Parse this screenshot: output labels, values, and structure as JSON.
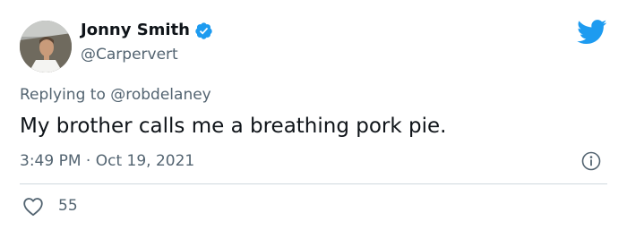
{
  "tweet": {
    "author": {
      "name": "Jonny Smith",
      "handle": "@Carpervert",
      "verified": true,
      "avatar_icon": "profile-photo"
    },
    "reply_prefix": "Replying to",
    "reply_to": "@robdelaney",
    "text": "My brother calls me a breathing pork pie.",
    "time": "3:49 PM",
    "separator": "·",
    "date": "Oct 19, 2021",
    "likes": "55"
  },
  "icons": {
    "brand": "twitter-bird-icon",
    "verified": "verified-badge-icon",
    "info": "info-icon",
    "like": "heart-icon"
  },
  "colors": {
    "twitter_blue": "#1d9bf0",
    "text": "#0f1419",
    "secondary": "#536471",
    "divider": "#cfd9de"
  }
}
